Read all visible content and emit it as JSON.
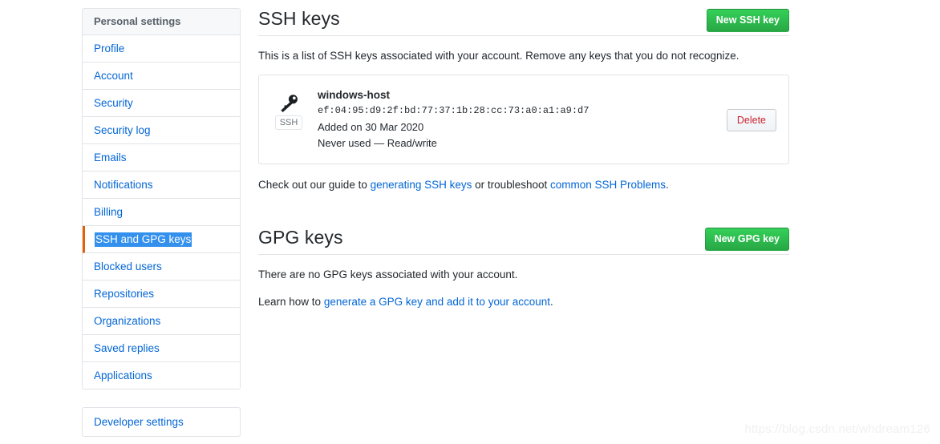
{
  "sidebar": {
    "header": "Personal settings",
    "items": [
      {
        "label": "Profile",
        "selected": false
      },
      {
        "label": "Account",
        "selected": false
      },
      {
        "label": "Security",
        "selected": false
      },
      {
        "label": "Security log",
        "selected": false
      },
      {
        "label": "Emails",
        "selected": false
      },
      {
        "label": "Notifications",
        "selected": false
      },
      {
        "label": "Billing",
        "selected": false
      },
      {
        "label": "SSH and GPG keys",
        "selected": true
      },
      {
        "label": "Blocked users",
        "selected": false
      },
      {
        "label": "Repositories",
        "selected": false
      },
      {
        "label": "Organizations",
        "selected": false
      },
      {
        "label": "Saved replies",
        "selected": false
      },
      {
        "label": "Applications",
        "selected": false
      }
    ],
    "developer_settings": "Developer settings",
    "selected_accent_color": "#e36209",
    "selection_highlight_color": "#3390ec",
    "link_color": "#0366d6"
  },
  "ssh_section": {
    "title": "SSH keys",
    "new_key_button": "New SSH key",
    "intro": "This is a list of SSH keys associated with your account. Remove any keys that you do not recognize.",
    "keys": [
      {
        "icon": "key-icon",
        "tag": "SSH",
        "title": "windows-host",
        "fingerprint": "ef:04:95:d9:2f:bd:77:37:1b:28:cc:73:a0:a1:a9:d7",
        "added": "Added on 30 Mar 2020",
        "usage": "Never used — Read/write",
        "delete_button": "Delete"
      }
    ],
    "guide_prefix": "Check out our guide to ",
    "guide_link_1": "generating SSH keys",
    "guide_middle": " or troubleshoot ",
    "guide_link_2": "common SSH Problems",
    "guide_suffix": "."
  },
  "gpg_section": {
    "title": "GPG keys",
    "new_key_button": "New GPG key",
    "empty_message": "There are no GPG keys associated with your account.",
    "learn_prefix": "Learn how to ",
    "learn_link": "generate a GPG key and add it to your account",
    "learn_suffix": "."
  },
  "theme": {
    "green_button": "#2cbe4e",
    "delete_text": "#cb2431",
    "border": "#e1e4e8",
    "header_bg": "#f6f8fa"
  },
  "watermark": "https://blog.csdn.net/whdream126"
}
